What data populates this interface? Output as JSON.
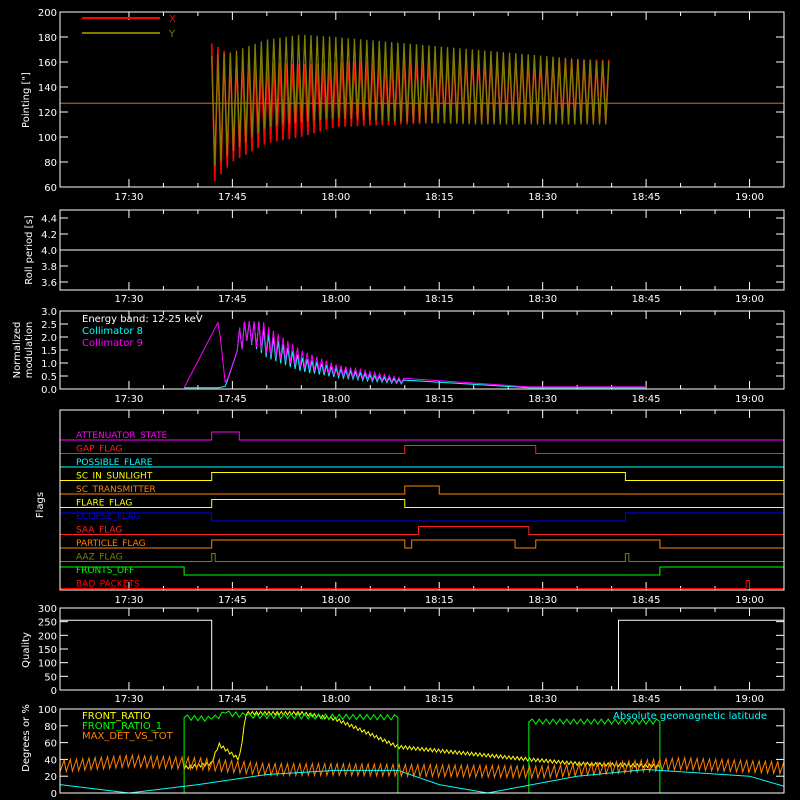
{
  "time_ticks": [
    "17:30",
    "17:45",
    "18:00",
    "18:15",
    "18:30",
    "18:45",
    "19:00"
  ],
  "colors": {
    "x_red": "#ff0000",
    "y_olive": "#808000",
    "cyan": "#00ffff",
    "magenta": "#ff00ff",
    "yellow": "#ffff00",
    "green": "#00ff00",
    "orange": "#ff8000",
    "blue": "#0000ff",
    "white": "#ffffff"
  },
  "chart_data": [
    {
      "type": "line",
      "panel": "pointing",
      "ylabel": "Pointing [\"]",
      "ylim": [
        60,
        200
      ],
      "yticks": [
        60,
        80,
        100,
        120,
        140,
        160,
        180,
        200
      ],
      "x_range": [
        "17:20",
        "19:05"
      ],
      "series": [
        {
          "name": "X",
          "color": "#ff0000",
          "baseline": 127,
          "x": [
            "17:42",
            "17:45",
            "17:50",
            "17:55",
            "18:00",
            "18:10",
            "18:20",
            "18:30",
            "18:40"
          ],
          "upper": [
            175,
            165,
            160,
            158,
            160,
            162,
            163,
            162,
            162
          ],
          "lower": [
            62,
            80,
            95,
            100,
            108,
            110,
            112,
            112,
            112
          ]
        },
        {
          "name": "Y",
          "color": "#808000",
          "baseline": 127,
          "x": [
            "17:42",
            "17:45",
            "17:50",
            "17:55",
            "18:00",
            "18:10",
            "18:20",
            "18:30",
            "18:40"
          ],
          "upper": [
            165,
            168,
            178,
            182,
            180,
            175,
            170,
            165,
            160
          ],
          "lower": [
            75,
            88,
            108,
            112,
            115,
            112,
            110,
            110,
            110
          ]
        }
      ]
    },
    {
      "type": "line",
      "panel": "roll",
      "ylabel": "Roll period [s]",
      "ylim": [
        3.5,
        4.5
      ],
      "yticks": [
        "3.6",
        "3.8",
        "4.0",
        "4.2",
        "4.4"
      ],
      "series": [
        {
          "color": "#ffffff",
          "x": [
            "17:20",
            "19:05"
          ],
          "y": [
            4.0,
            4.0
          ]
        }
      ]
    },
    {
      "type": "line",
      "panel": "modulation",
      "ylabel": "Normalized modulation",
      "ylim": [
        0,
        3
      ],
      "yticks": [
        "0.0",
        "0.5",
        "1.0",
        "1.5",
        "2.0",
        "2.5",
        "3.0"
      ],
      "annotation": "Energy band: 12-25 keV",
      "series": [
        {
          "name": "Collimator 8",
          "color": "#00ffff",
          "x": [
            "17:38",
            "17:43",
            "17:44",
            "17:47",
            "17:50",
            "17:55",
            "18:00",
            "18:05",
            "18:10",
            "18:28",
            "18:45"
          ],
          "y": [
            0.05,
            0.05,
            0.1,
            2.5,
            1.6,
            0.9,
            0.6,
            0.4,
            0.25,
            0.05,
            0.05
          ]
        },
        {
          "name": "Collimator 9",
          "color": "#ff00ff",
          "x": [
            "17:38",
            "17:43",
            "17:44",
            "17:47",
            "17:50",
            "17:55",
            "18:00",
            "18:05",
            "18:10",
            "18:28",
            "18:45"
          ],
          "y": [
            0.05,
            2.6,
            0.15,
            2.5,
            1.8,
            1.1,
            0.7,
            0.5,
            0.3,
            0.08,
            0.08
          ]
        }
      ]
    },
    {
      "type": "line",
      "panel": "flags",
      "ylabel": "Flags",
      "flags": [
        {
          "name": "ATTENUATOR_STATE",
          "color": "#ff00ff",
          "on": [
            [
              "17:42",
              "17:46"
            ]
          ]
        },
        {
          "name": "GAP_FLAG",
          "color": "#ff2020",
          "on": [
            [
              "18:10",
              "18:29"
            ]
          ]
        },
        {
          "name": "POSSIBLE_FLARE",
          "color": "#00ffff",
          "on": []
        },
        {
          "name": "SC_IN_SUNLIGHT",
          "color": "#ffff00",
          "on": [
            [
              "17:42",
              "18:42"
            ]
          ]
        },
        {
          "name": "SC_TRANSMITTER",
          "color": "#ff8000",
          "on": [
            [
              "18:10",
              "18:15"
            ]
          ]
        },
        {
          "name": "FLARE_FLAG",
          "color": "#ffff00",
          "on": [
            [
              "17:42",
              "18:10"
            ]
          ]
        },
        {
          "name": "ECLIPSE_FLAG",
          "color": "#0000ff",
          "on": [
            [
              "17:20",
              "17:42"
            ],
            [
              "18:42",
              "19:05"
            ]
          ]
        },
        {
          "name": "SAA_FLAG",
          "color": "#ff2020",
          "on": [
            [
              "18:12",
              "18:28"
            ]
          ]
        },
        {
          "name": "PARTICLE_FLAG",
          "color": "#ff8000",
          "on": [
            [
              "17:42",
              "18:10"
            ],
            [
              "18:11",
              "18:26"
            ],
            [
              "18:29",
              "18:47"
            ]
          ]
        },
        {
          "name": "AAZ_FLAG",
          "color": "#808000",
          "on": [
            [
              "17:42",
              "17:42.5"
            ],
            [
              "18:42",
              "18:42.5"
            ]
          ]
        },
        {
          "name": "FRONTS_OFF",
          "color": "#00ff00",
          "on": [
            [
              "17:20",
              "17:38"
            ],
            [
              "18:47",
              "19:05"
            ]
          ]
        },
        {
          "name": "BAD_PACKETS",
          "color": "#ff0000",
          "on": [
            [
              "18:59.5",
              "19:00"
            ]
          ]
        }
      ]
    },
    {
      "type": "line",
      "panel": "quality",
      "ylabel": "Quality",
      "ylim": [
        0,
        300
      ],
      "yticks": [
        0,
        50,
        100,
        150,
        200,
        250,
        300
      ],
      "series": [
        {
          "color": "#ffffff",
          "x": [
            "17:20",
            "17:42",
            "17:42",
            "18:41",
            "18:41",
            "19:05"
          ],
          "y": [
            255,
            255,
            0,
            0,
            255,
            255
          ]
        }
      ]
    },
    {
      "type": "line",
      "panel": "ratios",
      "ylabel": "Degrees or %",
      "ylim": [
        0,
        100
      ],
      "yticks": [
        0,
        20,
        40,
        60,
        80,
        100
      ],
      "series": [
        {
          "name": "FRONT_RATIO",
          "color": "#ffff00",
          "x": [
            "17:38",
            "17:42",
            "17:43",
            "17:46",
            "17:47",
            "17:55",
            "18:00",
            "18:05",
            "18:09",
            "18:28",
            "18:35",
            "18:47"
          ],
          "y": [
            30,
            35,
            58,
            40,
            95,
            95,
            88,
            70,
            55,
            40,
            35,
            32
          ]
        },
        {
          "name": "FRONT_RATIO_1",
          "color": "#00ff00",
          "x": [
            "17:20",
            "17:38",
            "17:38",
            "17:42",
            "17:44",
            "17:47",
            "18:09",
            "18:09",
            "18:28",
            "18:28",
            "18:47",
            "18:47",
            "19:05"
          ],
          "y": [
            0,
            0,
            90,
            88,
            95,
            92,
            90,
            0,
            0,
            85,
            85,
            0,
            0
          ]
        },
        {
          "name": "MAX_DET_VS_TOT",
          "color": "#ff8000",
          "x": [
            "17:20",
            "17:30",
            "17:40",
            "17:50",
            "18:00",
            "18:10",
            "18:20",
            "18:30",
            "18:40",
            "18:50",
            "19:05"
          ],
          "y": [
            32,
            38,
            35,
            28,
            28,
            27,
            26,
            25,
            30,
            35,
            30
          ]
        },
        {
          "name": "Absolute geomagnetic latitude",
          "color": "#00ffff",
          "x": [
            "17:20",
            "17:30",
            "17:40",
            "17:50",
            "18:00",
            "18:09",
            "18:15",
            "18:22",
            "18:35",
            "18:45",
            "19:00",
            "19:05"
          ],
          "y": [
            10,
            0,
            10,
            22,
            27,
            27,
            10,
            0,
            20,
            28,
            20,
            8
          ]
        }
      ]
    }
  ]
}
